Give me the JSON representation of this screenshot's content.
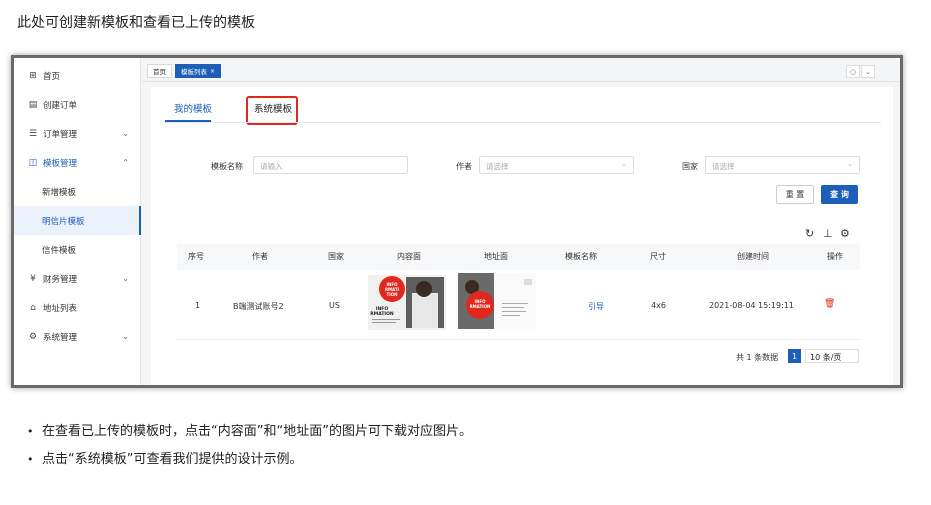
{
  "intro_text": "此处可创建新模板和查看已上传的模板",
  "sidebar": {
    "items": [
      {
        "icon": "grid-icon",
        "glyph": "⊞",
        "label": "首页"
      },
      {
        "icon": "calendar-icon",
        "glyph": "▤",
        "label": "创建订单"
      },
      {
        "icon": "list-icon",
        "glyph": "☰",
        "label": "订单管理",
        "chevron": "⌄"
      },
      {
        "icon": "template-icon",
        "glyph": "◫",
        "label": "模板管理",
        "chevron": "⌃"
      },
      {
        "label": "新增模板"
      },
      {
        "label": "明信片模板"
      },
      {
        "label": "信件模板"
      },
      {
        "icon": "money-icon",
        "glyph": "¥",
        "label": "财务管理",
        "chevron": "⌄"
      },
      {
        "icon": "home-icon",
        "glyph": "⌂",
        "label": "地址列表"
      },
      {
        "icon": "gear-icon",
        "glyph": "⚙",
        "label": "系统管理",
        "chevron": "⌄"
      }
    ]
  },
  "breadcrumbs": [
    "首页",
    "模板列表"
  ],
  "tabs": {
    "mine": "我的模板",
    "system": "系统模板"
  },
  "filters": {
    "name_label": "模板名称",
    "name_placeholder": "请输入",
    "author_label": "作者",
    "author_placeholder": "请选择",
    "country_label": "国家",
    "country_placeholder": "请选择"
  },
  "buttons": {
    "reset": "重 置",
    "query": "查 询"
  },
  "table": {
    "headers": [
      "序号",
      "作者",
      "国家",
      "内容面",
      "地址面",
      "模板名称",
      "尺寸",
      "创建时间",
      "操作"
    ],
    "row": {
      "index": "1",
      "author": "B端测试账号2",
      "country": "US",
      "template_name": "引导",
      "size": "4x6",
      "created": "2021-08-04 15:19:11"
    },
    "front_image_text": [
      "INFO",
      "RMATI",
      "TION",
      "INFO",
      "RMATION"
    ],
    "back_image_text": [
      "INFO",
      "RMATION"
    ]
  },
  "pagination": {
    "total": "共 1 条数据",
    "page": "1",
    "size": "10 条/页"
  },
  "bullets": [
    "在查看已上传的模板时，点击“内容面”和“地址面”的图片可下载对应图片。",
    "点击“系统模板”可查看我们提供的设计示例。"
  ],
  "colors": {
    "primary": "#1d5fb8",
    "highlight": "#e0281f"
  }
}
